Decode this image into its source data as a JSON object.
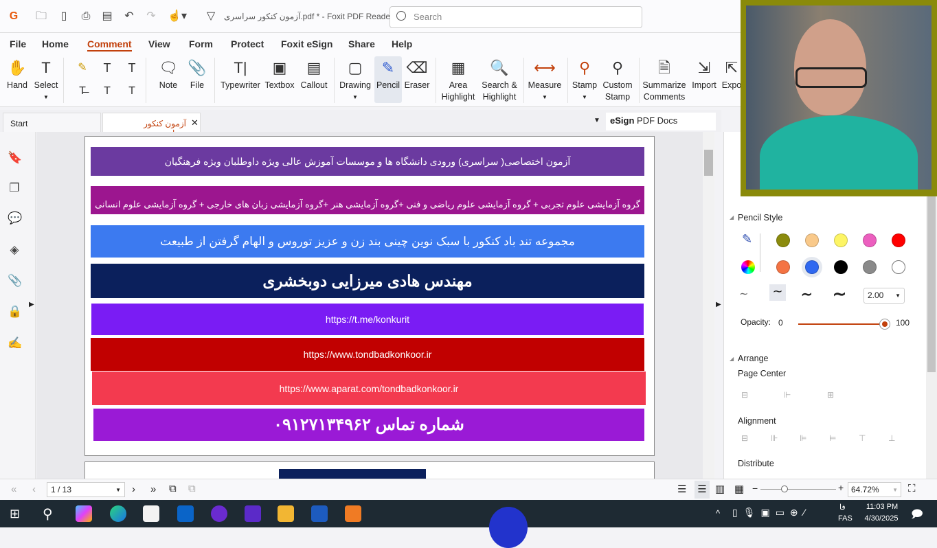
{
  "app": {
    "title": "آزمون کنکور سراسری.pdf * - Foxit PDF Reader",
    "search_placeholder": "Search"
  },
  "menu": [
    "File",
    "Home",
    "Comment",
    "View",
    "Form",
    "Protect",
    "Foxit eSign",
    "Share",
    "Help"
  ],
  "ribbon": {
    "hand": "Hand",
    "select": "Select",
    "note": "Note",
    "file": "File",
    "typewriter": "Typewriter",
    "textbox": "Textbox",
    "callout": "Callout",
    "drawing": "Drawing",
    "pencil": "Pencil",
    "eraser": "Eraser",
    "area_highlight": "Area Highlight",
    "search_highlight": "Search & Highlight",
    "measure": "Measure",
    "stamp": "Stamp",
    "custom_stamp": "Custom Stamp",
    "summarize": "Summarize Comments",
    "import": "Import",
    "export": "Expo"
  },
  "tabs": {
    "start": "Start",
    "doc": "آزمون کنکور سراسری ....",
    "esign_bold": "eSign",
    "esign_rest": " PDF Docs"
  },
  "banners": [
    {
      "text": "آزمون اختصاصی( سراسری) ورودی دانشگاه ها و موسسات آموزش عالی ویژه داوطلبان ویژه فرهنگیان",
      "color": "#6b3aa0"
    },
    {
      "text": "گروه آزمایشی علوم تجربی + گروه آزمایشی علوم ریاضی و فنی +گروه آزمایشی هنر +گروه آزمایشی زبان های خارجی + گروه آزمایشی علوم انسانی",
      "color": "#9c168f"
    },
    {
      "text": "مجموعه تند باد کنکور با سبک نوین چینی بند زن و عزیز توروس و الهام گرفتن از طبیعت",
      "color": "#3c7af0"
    },
    {
      "text": "مهندس هادی میرزایی دوبخشری",
      "color": "#0b205c"
    },
    {
      "text": "https://t.me/konkurit",
      "color": "#7a1cf4"
    },
    {
      "text": "https://www.tondbadkonkoor.ir",
      "color": "#c10000"
    },
    {
      "text": "https://www.aparat.com/tondbadkonkoor.ir",
      "color": "#f33a4f"
    },
    {
      "text": "شماره تماس ۰۹۱۲۷۱۳۴۹۶۲",
      "color": "#9a1ad6"
    }
  ],
  "panel": {
    "pencil_style": "Pencil Style",
    "thickness": "2.00",
    "opacity_label": "Opacity:",
    "opacity_min": "0",
    "opacity_max": "100",
    "opacity_value": 100,
    "arrange": "Arrange",
    "page_center": "Page Center",
    "alignment": "Alignment",
    "distribute": "Distribute",
    "colors": [
      "#8b8b0d",
      "#f9c98a",
      "#fdf565",
      "#ec5fbf",
      "#ff0000",
      "#f47343",
      "#2f68f0",
      "#000000",
      "#8a8a8a",
      "#ffffff"
    ],
    "selected_color": "#2f68f0"
  },
  "status": {
    "page": "1 / 13",
    "zoom": "64.72%"
  },
  "taskbar": {
    "time": "11:03 PM",
    "date": "4/30/2025",
    "lang": "FAS",
    "lang2": "فا"
  }
}
